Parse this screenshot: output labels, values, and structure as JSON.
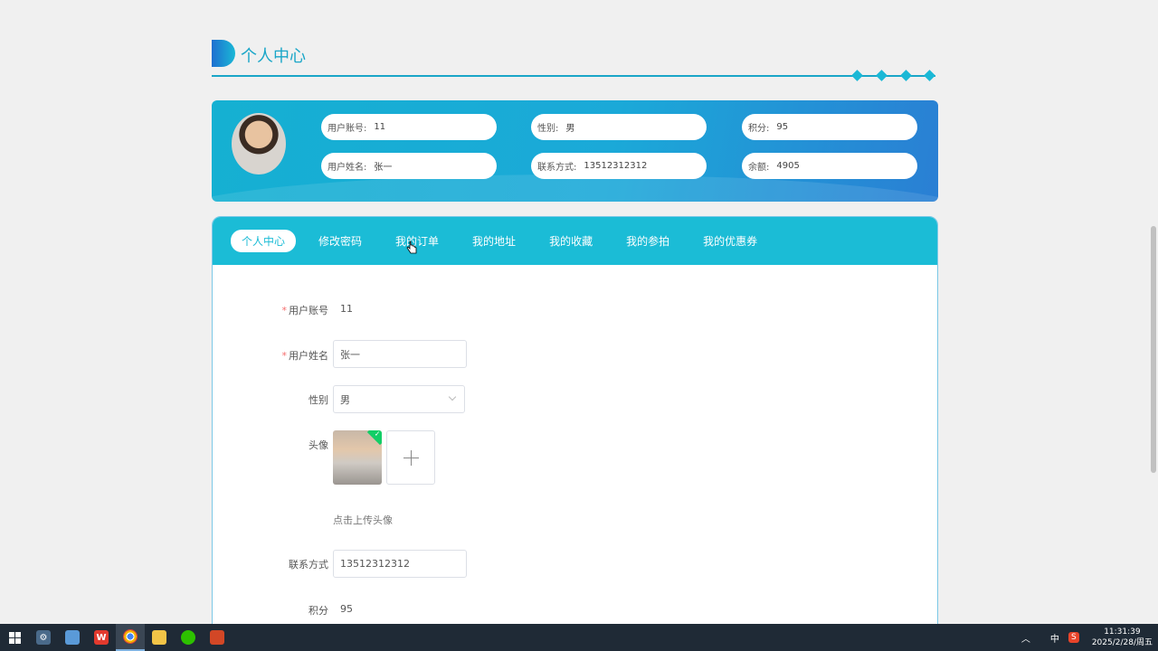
{
  "header": {
    "title": "个人中心"
  },
  "user_card": {
    "fields": [
      {
        "label": "用户账号:",
        "value": "11"
      },
      {
        "label": "性别:",
        "value": "男"
      },
      {
        "label": "积分:",
        "value": "95"
      },
      {
        "label": "用户姓名:",
        "value": "张一"
      },
      {
        "label": "联系方式:",
        "value": "13512312312"
      },
      {
        "label": "余额:",
        "value": "4905"
      }
    ]
  },
  "tabs": [
    {
      "label": "个人中心",
      "active": true
    },
    {
      "label": "修改密码"
    },
    {
      "label": "我的订单"
    },
    {
      "label": "我的地址"
    },
    {
      "label": "我的收藏"
    },
    {
      "label": "我的参拍"
    },
    {
      "label": "我的优惠券"
    }
  ],
  "form": {
    "account": {
      "label": "用户账号",
      "value": "11",
      "required": true
    },
    "name": {
      "label": "用户姓名",
      "value": "张一",
      "required": true
    },
    "gender": {
      "label": "性别",
      "value": "男"
    },
    "avatar": {
      "label": "头像",
      "hint": "点击上传头像"
    },
    "phone": {
      "label": "联系方式",
      "value": "13512312312"
    },
    "points": {
      "label": "积分",
      "value": "95"
    }
  },
  "taskbar": {
    "ime": "中",
    "time": "11:31:39",
    "date": "2025/2/28/周五"
  },
  "colors": {
    "accent": "#1bbcd6",
    "required": "#f56c6c",
    "success": "#13ce66"
  }
}
